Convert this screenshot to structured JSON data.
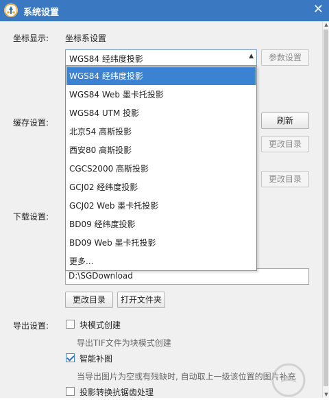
{
  "window": {
    "title": "系统设置",
    "close_glyph": "✕"
  },
  "coord": {
    "section_label": "坐标显示:",
    "sub_label": "坐标系设置",
    "selected": "WGS84 经纬度投影",
    "param_button": "参数设置",
    "options": [
      "WGS84 经纬度投影",
      "WGS84 Web 墨卡托投影",
      "WGS84 UTM 投影",
      "北京54 高斯投影",
      "西安80 高斯投影",
      "CGCS2000 高斯投影",
      "GCJ02 经纬度投影",
      "GCJ02 Web 墨卡托投影",
      "BD09 经纬度投影",
      "BD09 Web 墨卡托投影",
      "更多..."
    ]
  },
  "cache": {
    "section_label": "缓存设置:",
    "refresh_button": "刷新",
    "change_dir_button_1": "更改目录",
    "change_dir_button_2": "更改目录"
  },
  "download": {
    "section_label": "下载设置:",
    "path_value": "D:\\SGDownload",
    "change_dir_button": "更改目录",
    "open_folder_button": "打开文件夹"
  },
  "export": {
    "section_label": "导出设置:",
    "block_mode_label": "块模式创建",
    "block_mode_checked": false,
    "block_mode_desc": "导出TIF文件为块模式创建",
    "smart_fill_label": "智能补图",
    "smart_fill_checked": true,
    "smart_fill_desc": "当导出图片为空或有残缺时, 自动取上一级该位置的图片补充",
    "antialias_label": "投影转换抗锯齿处理",
    "antialias_checked": false
  }
}
